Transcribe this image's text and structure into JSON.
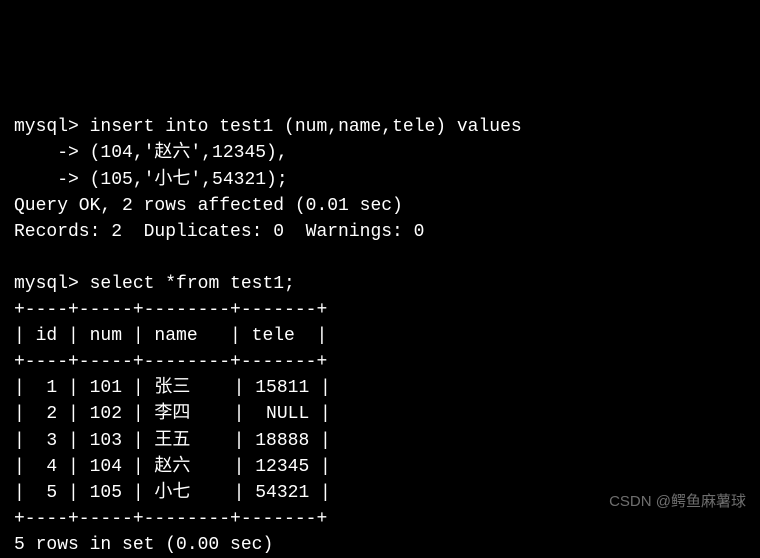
{
  "terminal": {
    "prompt": "mysql>",
    "continuation": "    ->",
    "insert_cmd": "insert into test1 (num,name,tele) values",
    "insert_line2": "(104,'赵六',12345),",
    "insert_line3": "(105,'小七',54321);",
    "query_ok": "Query OK, 2 rows affected (0.01 sec)",
    "records_line": "Records: 2  Duplicates: 0  Warnings: 0",
    "select_cmd": "select *from test1;",
    "table_border": "+----+-----+--------+-------+",
    "table_header": "| id | num | name   | tele  |",
    "result_footer": "5 rows in set (0.00 sec)"
  },
  "chart_data": {
    "type": "table",
    "columns": [
      "id",
      "num",
      "name",
      "tele"
    ],
    "rows": [
      {
        "id": 1,
        "num": 101,
        "name": "张三",
        "tele": "15811"
      },
      {
        "id": 2,
        "num": 102,
        "name": "李四",
        "tele": "NULL"
      },
      {
        "id": 3,
        "num": 103,
        "name": "王五",
        "tele": "18888"
      },
      {
        "id": 4,
        "num": 104,
        "name": "赵六",
        "tele": "12345"
      },
      {
        "id": 5,
        "num": 105,
        "name": "小七",
        "tele": "54321"
      }
    ]
  },
  "watermark": "CSDN @鳄鱼麻薯球"
}
